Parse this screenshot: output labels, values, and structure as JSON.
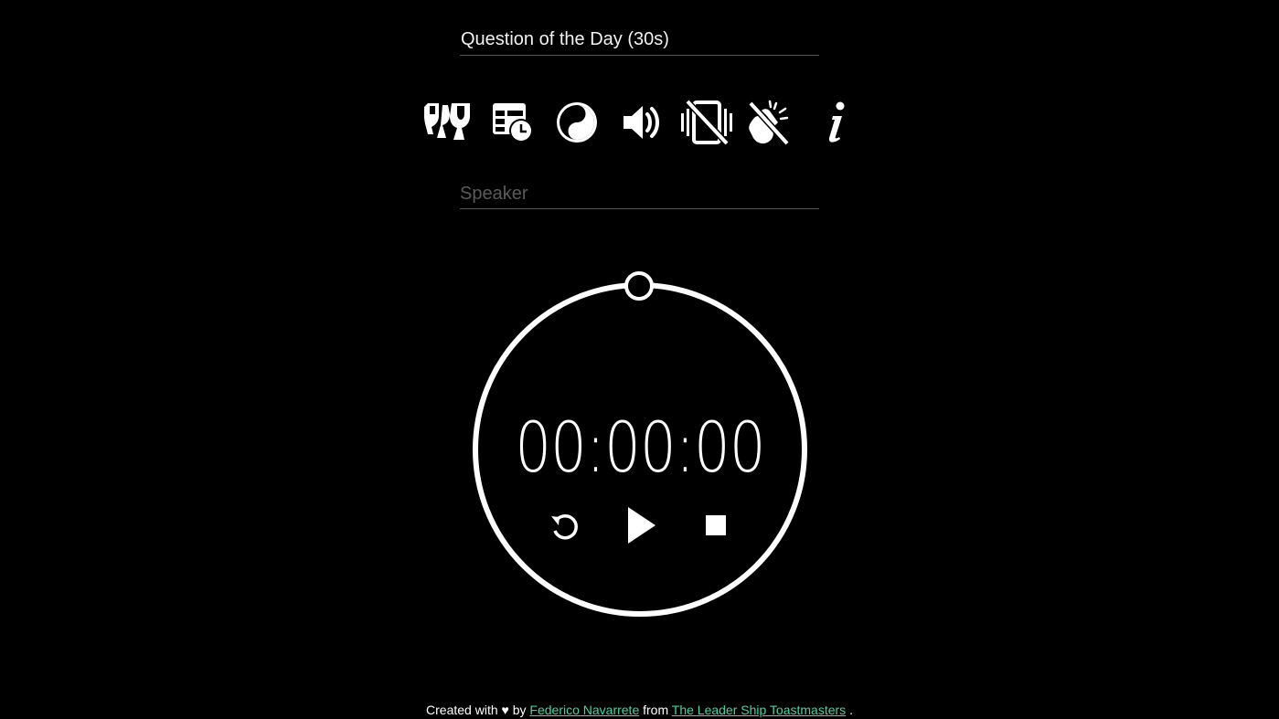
{
  "speech_type": {
    "value": "Question of the Day (30s)"
  },
  "toolbar": {
    "items": [
      {
        "name": "trophy-icon"
      },
      {
        "name": "schedule-table-icon"
      },
      {
        "name": "yin-yang-icon"
      },
      {
        "name": "volume-icon"
      },
      {
        "name": "vibration-off-icon"
      },
      {
        "name": "applause-off-icon"
      },
      {
        "name": "info-icon"
      }
    ]
  },
  "speaker": {
    "placeholder": "Speaker",
    "value": ""
  },
  "timer": {
    "display": "00:00:00",
    "progress": 0
  },
  "footer": {
    "prefix": "Created with ♥ by",
    "author": "Federico Navarrete",
    "middle": "from",
    "club": "The Leader Ship Toastmasters",
    "suffix": "."
  },
  "colors": {
    "background": "#000000",
    "foreground": "#ffffff",
    "link": "#3fd6a8"
  }
}
